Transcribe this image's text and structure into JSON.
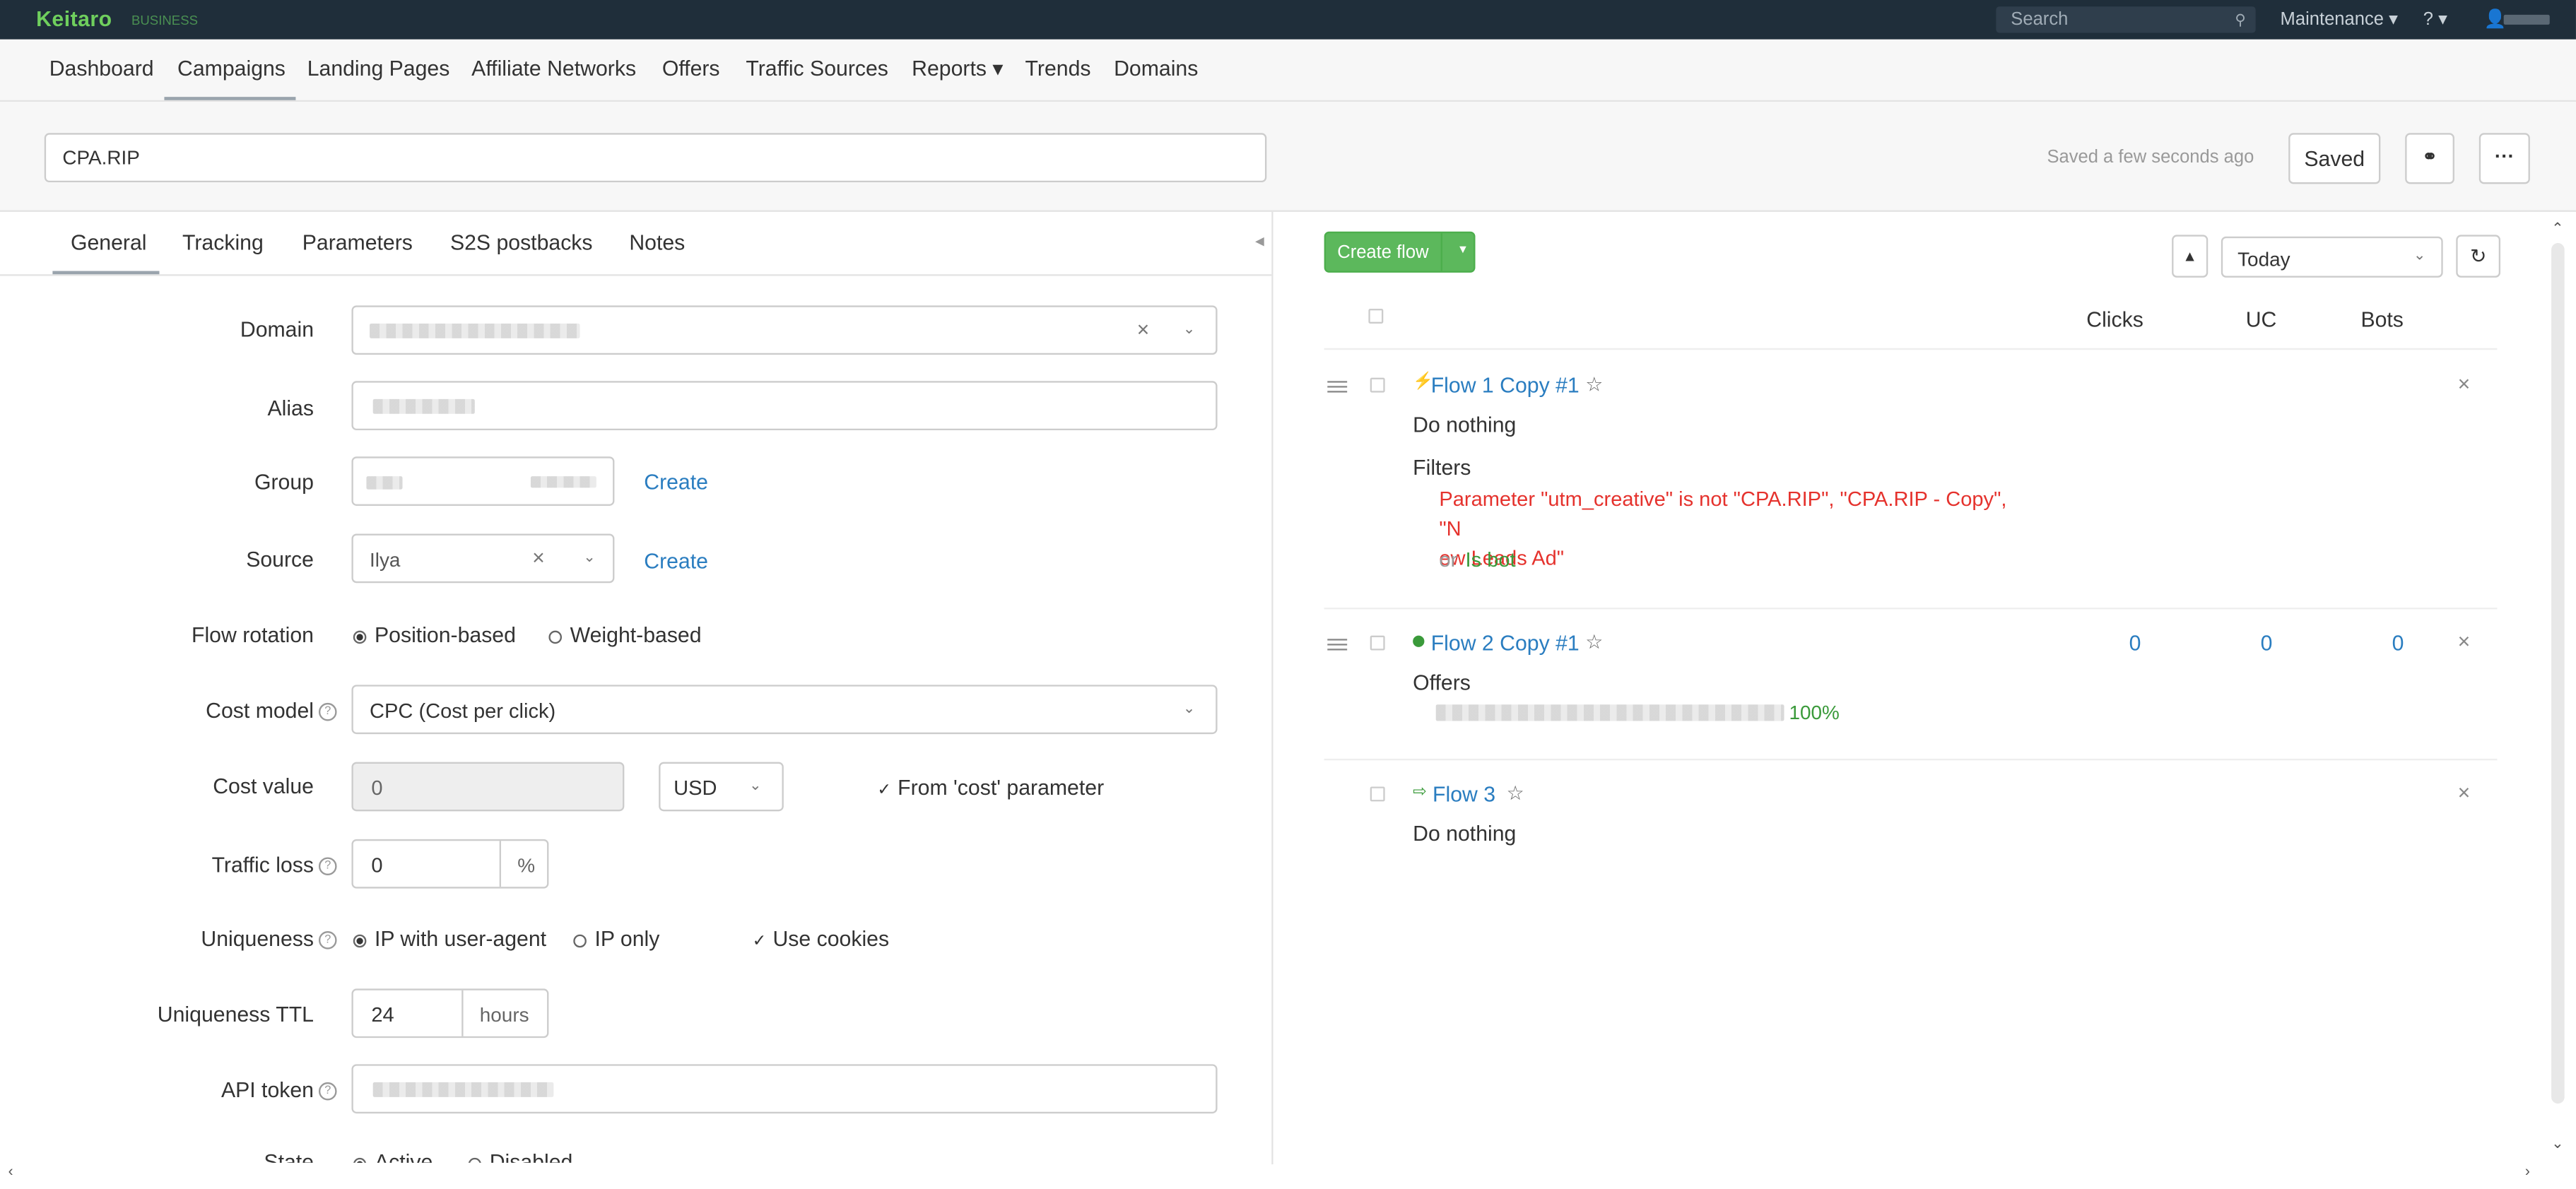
{
  "topbar": {
    "logo": "Keitaro",
    "logo_sub": "BUSINESS",
    "search_placeholder": "Search",
    "maintenance": "Maintenance ▾",
    "help": "? ▾"
  },
  "nav": [
    "Dashboard",
    "Campaigns",
    "Landing Pages",
    "Affiliate Networks",
    "Offers",
    "Traffic Sources",
    "Reports ▾",
    "Trends",
    "Domains"
  ],
  "header": {
    "campaign_name": "CPA.RIP",
    "saved_text": "Saved a few seconds ago",
    "saved_button": "Saved"
  },
  "tabs": [
    "General",
    "Tracking",
    "Parameters",
    "S2S postbacks",
    "Notes"
  ],
  "form": {
    "domain_label": "Domain",
    "alias_label": "Alias",
    "group_label": "Group",
    "source_label": "Source",
    "source_value": "Ilya",
    "create_link": "Create",
    "flow_rotation_label": "Flow rotation",
    "rotation_options": [
      "Position-based",
      "Weight-based"
    ],
    "cost_model_label": "Cost model",
    "cost_model_value": "CPC (Cost per click)",
    "cost_value_label": "Cost value",
    "cost_value": "0",
    "currency": "USD",
    "from_cost_param": "From 'cost' parameter",
    "traffic_loss_label": "Traffic loss",
    "traffic_loss_value": "0",
    "percent": "%",
    "uniqueness_label": "Uniqueness",
    "uniqueness_options": [
      "IP with user-agent",
      "IP only"
    ],
    "use_cookies": "Use cookies",
    "uniqueness_ttl_label": "Uniqueness TTL",
    "ttl_value": "24",
    "ttl_unit": "hours",
    "api_token_label": "API token",
    "state_label": "State",
    "state_options": [
      "Active",
      "Disabled"
    ]
  },
  "flows_panel": {
    "create_flow": "Create flow",
    "period": "Today",
    "columns": [
      "Clicks",
      "UC",
      "Bots"
    ],
    "flows": [
      {
        "name": "Flow 1 Copy #1",
        "action": "Do nothing",
        "filters_label": "Filters",
        "filter_line1": "Parameter \"utm_creative\"  is not \"CPA.RIP\", \"CPA.RIP - Copy\", \"N",
        "filter_line2": "ew Leads Ad\"",
        "or_text": "or",
        "or_filter": "Is bot"
      },
      {
        "name": "Flow 2 Copy #1",
        "offers_label": "Offers",
        "offer_share": "100%",
        "clicks": "0",
        "uc": "0",
        "bots": "0"
      },
      {
        "name": "Flow 3",
        "action": "Do nothing"
      }
    ]
  },
  "colors": {
    "topbar_bg": "#1f2e3a",
    "brand_green": "#6fcf5d",
    "button_green": "#5cb85c",
    "link_blue": "#2a7dc0",
    "filter_red": "#e5322d"
  }
}
